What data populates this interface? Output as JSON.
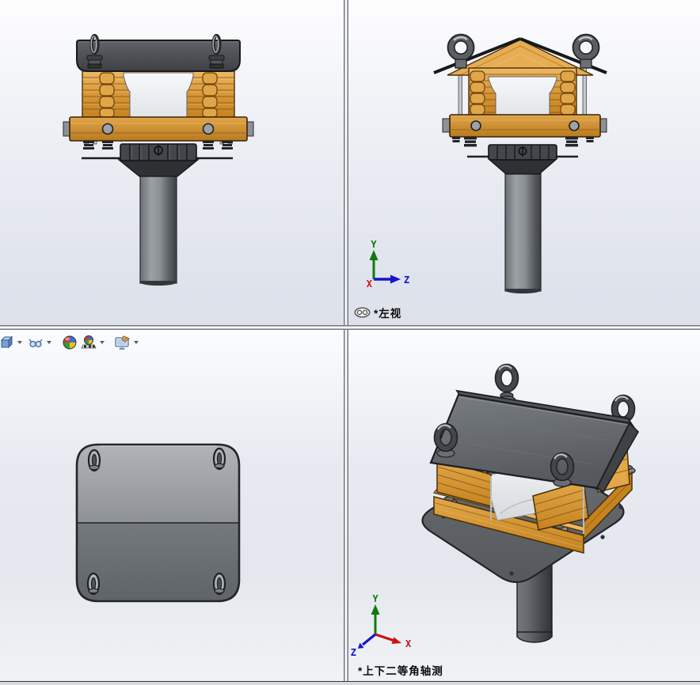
{
  "viewports": {
    "front": {
      "name": "front-view"
    },
    "left": {
      "name": "left-view",
      "label": "*左视",
      "has_link_icon": true
    },
    "top": {
      "name": "top-view"
    },
    "iso": {
      "name": "isometric-view",
      "label": "*上下二等角轴测"
    }
  },
  "triad": {
    "x": "X",
    "y": "Y",
    "z": "Z"
  },
  "toolbar": {
    "items": [
      {
        "name": "view-orientation",
        "icon": "cube-icon",
        "has_dropdown": true
      },
      {
        "name": "hide-show-items",
        "icon": "glasses-icon",
        "has_dropdown": true
      },
      {
        "name": "edit-appearance",
        "icon": "appearance-ball-icon",
        "has_dropdown": false
      },
      {
        "name": "apply-scene",
        "icon": "scene-ball-icon",
        "has_dropdown": true
      },
      {
        "name": "view-settings",
        "icon": "monitor-hand-icon",
        "has_dropdown": true
      }
    ]
  },
  "colors": {
    "wood": "#d79738",
    "wood_light": "#ecb964",
    "roof_gray": "#4c5054",
    "pole_gray": "#8b9095",
    "plate_light": "#9ba0a4",
    "plate_dark": "#696e72",
    "axis_x": "#cc1111",
    "axis_y": "#0e7a0e",
    "axis_z": "#1414cc",
    "background_top": "#fdfdfe",
    "background_bottom": "#dde1ea"
  }
}
